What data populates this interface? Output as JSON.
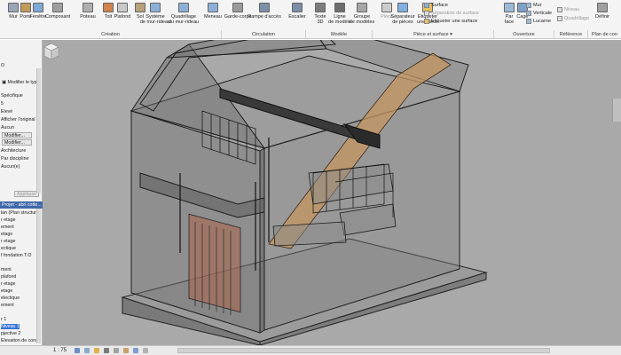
{
  "ribbon": {
    "tools": [
      {
        "label": "Mur",
        "icon": "wall-icon"
      },
      {
        "label": "Porte",
        "icon": "door-icon"
      },
      {
        "label": "Fenêtre",
        "icon": "window-icon"
      },
      {
        "label": "Composant",
        "icon": "component-icon"
      },
      {
        "label": "Poteau",
        "icon": "column-icon"
      },
      {
        "label": "Toit",
        "icon": "roof-icon"
      },
      {
        "label": "Plafond",
        "icon": "ceiling-icon"
      },
      {
        "label": "Sol",
        "icon": "floor-icon"
      },
      {
        "label": "Système\nde mur-rideau",
        "icon": "curtain-system-icon"
      },
      {
        "label": "Quadrillage\ndu mur-rideau",
        "icon": "curtain-grid-icon"
      },
      {
        "label": "Meneau",
        "icon": "mullion-icon"
      },
      {
        "label": "Garde-corps",
        "icon": "railing-icon"
      },
      {
        "label": "Rampe d'accès",
        "icon": "ramp-icon"
      },
      {
        "label": "Escalier",
        "icon": "stair-icon"
      },
      {
        "label": "Texte\n3D",
        "icon": "model-text-icon"
      },
      {
        "label": "Ligne\nde modèle",
        "icon": "model-line-icon"
      },
      {
        "label": "Groupe\nde modèles",
        "icon": "model-group-icon"
      },
      {
        "label": "Pièce",
        "icon": "room-icon"
      },
      {
        "label": "Séparateur\nde pièces",
        "icon": "room-separator-icon"
      },
      {
        "label": "Etiqueter\nune pièce",
        "icon": "tag-room-icon"
      },
      {
        "label": "Par\nface",
        "icon": "by-face-icon"
      },
      {
        "label": "Cage",
        "icon": "shaft-icon"
      },
      {
        "label": "Définir",
        "icon": "set-workplane-icon"
      }
    ],
    "small_items": {
      "surface": "Surface",
      "separation_surface": "Séparation de surface",
      "tag_surface": "Etiqueter une surface",
      "mur": "Mur",
      "verticale": "Verticale",
      "lucarne": "Lucarne",
      "niveau": "Niveau",
      "quadrillage": "Quadrillage"
    },
    "groups": [
      "Création",
      "Circulation",
      "Modèle",
      "Pièce et surface ▾",
      "Ouverture",
      "Référence",
      "Plan de con"
    ]
  },
  "left_panel": {
    "type_selector": "O",
    "modify_type": "Modifier le type",
    "prop_lines": [
      "Spécifique",
      "5",
      "Elevé",
      "Afficher l'original",
      "Aucun"
    ],
    "modify_btn_1": "Modifier...",
    "modify_btn_2": "Modifier...",
    "prop_lines_2": [
      "Architecture",
      "Par discipline",
      "Aucun(e)"
    ],
    "apply_button": "Appliquer",
    "browser_header": "Projet - abri cotte...",
    "browser_items": [
      "lan (Plan structurel",
      "r etage",
      "ement",
      "etage",
      "r etage",
      "ectique",
      "f fondation T.O",
      "",
      "ment",
      "plafond",
      "r etage",
      "etage",
      "électique",
      "ement",
      "",
      "r 1",
      "Niveau 1",
      "pjective 2",
      "Elevation de const"
    ],
    "selected_item": "Niveau 1"
  },
  "status_bar": {
    "scale": "1 : 75"
  },
  "colors": {
    "viewport_bg": "#a9a9a9",
    "ribbon_bg": "#f4f4f4",
    "browser_header": "#3f68a9",
    "selected": "#3875d7",
    "accent_wood": "#c49560",
    "wall_tint": "#6b6b6b"
  }
}
